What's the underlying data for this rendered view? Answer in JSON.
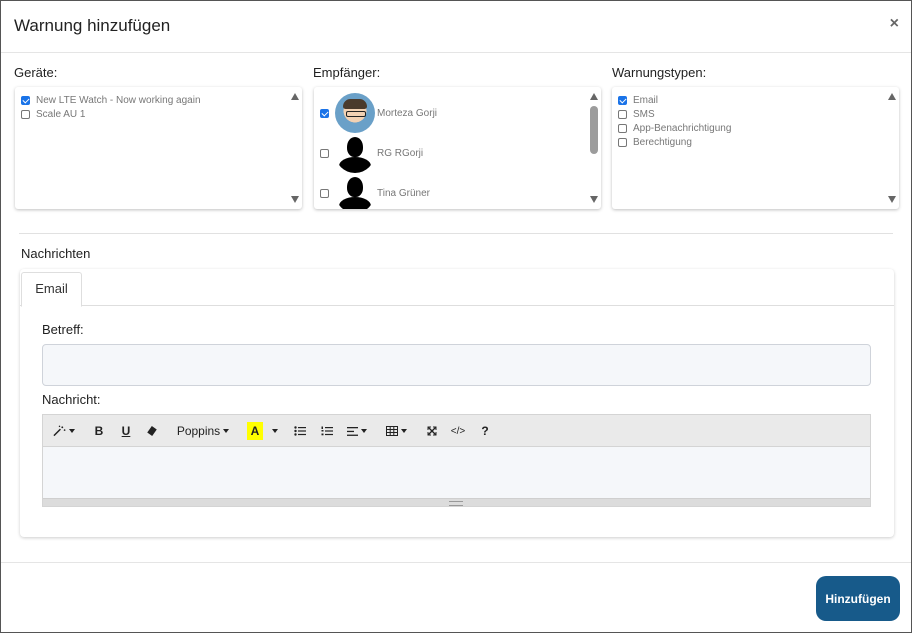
{
  "modal": {
    "title": "Warnung hinzufügen",
    "close_icon": "×"
  },
  "devices": {
    "label": "Geräte:",
    "items": [
      {
        "label": "New LTE Watch - Now working again",
        "checked": true
      },
      {
        "label": "Scale AU 1",
        "checked": false
      }
    ]
  },
  "recipients": {
    "label": "Empfänger:",
    "items": [
      {
        "name": "Morteza Gorji",
        "checked": true,
        "avatar": "photo"
      },
      {
        "name": "RG RGorji",
        "checked": false,
        "avatar": "silhouette"
      },
      {
        "name": "Tina Grüner",
        "checked": false,
        "avatar": "silhouette"
      }
    ]
  },
  "warning_types": {
    "label": "Warnungstypen:",
    "items": [
      {
        "label": "Email",
        "checked": true
      },
      {
        "label": "SMS",
        "checked": false
      },
      {
        "label": "App-Benachrichtigung",
        "checked": false
      },
      {
        "label": "Berechtigung",
        "checked": false
      }
    ]
  },
  "messages": {
    "title": "Nachrichten",
    "tabs": [
      {
        "label": "Email"
      }
    ],
    "subject_label": "Betreff:",
    "subject_value": "",
    "message_label": "Nachricht:",
    "toolbar": {
      "magic": "magic-wand-icon",
      "bold": "B",
      "underline": "U",
      "eraser": "eraser-icon",
      "font": "Poppins",
      "highlight": "A",
      "ul": "unordered-list-icon",
      "ol": "ordered-list-icon",
      "align": "align-icon",
      "table": "table-icon",
      "fullscreen": "fullscreen-icon",
      "code": "</>",
      "help": "?"
    }
  },
  "footer": {
    "submit_label": "Hinzufügen"
  },
  "colors": {
    "primary_button": "#175a8a",
    "checkbox_checked": "#1a73e8",
    "highlight_yellow": "#ffff00"
  }
}
